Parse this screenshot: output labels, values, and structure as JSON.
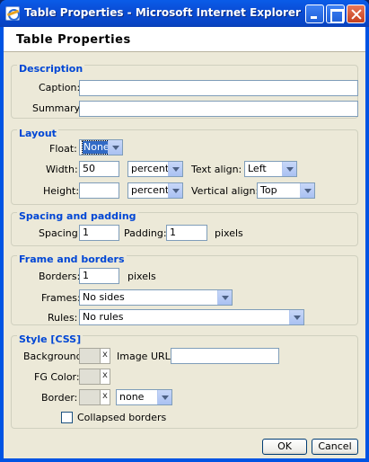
{
  "window": {
    "title": "Table Properties - Microsoft Internet Explorer"
  },
  "dialog": {
    "header": "Table Properties"
  },
  "description": {
    "legend": "Description",
    "caption_label": "Caption:",
    "caption_value": "",
    "summary_label": "Summary:",
    "summary_value": ""
  },
  "layout": {
    "legend": "Layout",
    "float_label": "Float:",
    "float_value": "None",
    "width_label": "Width:",
    "width_value": "50",
    "width_unit": "percent",
    "text_align_label": "Text align:",
    "text_align_value": "Left",
    "height_label": "Height:",
    "height_value": "",
    "height_unit": "percent",
    "vertical_align_label": "Vertical align:",
    "vertical_align_value": "Top"
  },
  "spacing": {
    "legend": "Spacing and padding",
    "spacing_label": "Spacing:",
    "spacing_value": "1",
    "padding_label": "Padding:",
    "padding_value": "1",
    "unit": "pixels"
  },
  "frame": {
    "legend": "Frame and borders",
    "borders_label": "Borders:",
    "borders_value": "1",
    "borders_unit": "pixels",
    "frames_label": "Frames:",
    "frames_value": "No sides",
    "rules_label": "Rules:",
    "rules_value": "No rules"
  },
  "style": {
    "legend": "Style [CSS]",
    "background_label": "Background:",
    "image_url_label": "Image URL:",
    "image_url_value": "",
    "fg_color_label": "FG Color:",
    "border_label": "Border:",
    "border_style_value": "none",
    "clear_glyph": "x",
    "collapsed_label": "Collapsed borders",
    "collapsed_checked": false
  },
  "buttons": {
    "ok": "OK",
    "cancel": "Cancel"
  },
  "colors": {
    "legend": "#0046d5",
    "titlebar": "#0054e3",
    "face": "#ece9d8"
  }
}
